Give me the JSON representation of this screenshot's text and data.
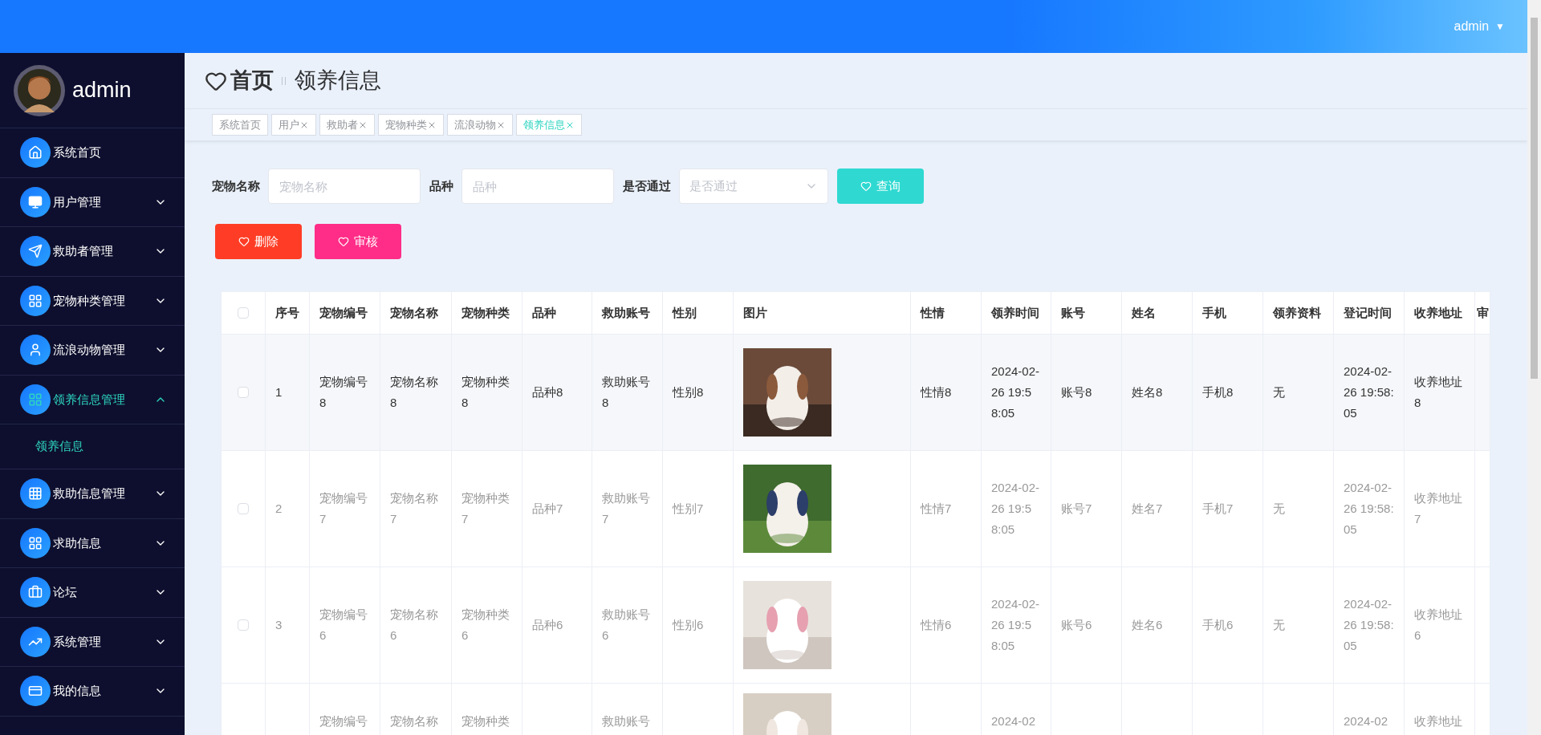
{
  "topbar": {
    "user": "admin",
    "caret": "▼"
  },
  "sidebar": {
    "user": "admin",
    "items": [
      {
        "label": "系统首页",
        "has_children": false,
        "active": false
      },
      {
        "label": "用户管理",
        "has_children": true,
        "expanded": false,
        "active": false
      },
      {
        "label": "救助者管理",
        "has_children": true,
        "expanded": false,
        "active": false
      },
      {
        "label": "宠物种类管理",
        "has_children": true,
        "expanded": false,
        "active": false
      },
      {
        "label": "流浪动物管理",
        "has_children": true,
        "expanded": false,
        "active": false
      },
      {
        "label": "领养信息管理",
        "has_children": true,
        "expanded": true,
        "active": true,
        "children": [
          {
            "label": "领养信息",
            "selected": true
          }
        ]
      },
      {
        "label": "救助信息管理",
        "has_children": true,
        "expanded": false,
        "active": false
      },
      {
        "label": "求助信息",
        "has_children": true,
        "expanded": false,
        "active": false
      },
      {
        "label": "论坛",
        "has_children": true,
        "expanded": false,
        "active": false
      },
      {
        "label": "系统管理",
        "has_children": true,
        "expanded": false,
        "active": false
      },
      {
        "label": "我的信息",
        "has_children": true,
        "expanded": false,
        "active": false
      }
    ]
  },
  "breadcrumb": {
    "home": "首页",
    "current": "领养信息"
  },
  "tabs": [
    {
      "label": "系统首页",
      "closable": false,
      "selected": false
    },
    {
      "label": "用户",
      "closable": true,
      "selected": false
    },
    {
      "label": "救助者",
      "closable": true,
      "selected": false
    },
    {
      "label": "宠物种类",
      "closable": true,
      "selected": false
    },
    {
      "label": "流浪动物",
      "closable": true,
      "selected": false
    },
    {
      "label": "领养信息",
      "closable": true,
      "selected": true
    }
  ],
  "search": {
    "fields": [
      {
        "label": "宠物名称",
        "placeholder": "宠物名称",
        "kind": "input"
      },
      {
        "label": "品种",
        "placeholder": "品种",
        "kind": "input"
      },
      {
        "label": "是否通过",
        "placeholder": "是否通过",
        "kind": "select"
      }
    ],
    "button": "查询"
  },
  "actions": [
    {
      "label": "删除",
      "color": "#ff3d26"
    },
    {
      "label": "审核",
      "color": "#ff2d87"
    }
  ],
  "table": {
    "all_checked": false,
    "columns": [
      "序号",
      "宠物编号",
      "宠物名称",
      "宠物种类",
      "品种",
      "救助账号",
      "性别",
      "图片",
      "性情",
      "领养时间",
      "账号",
      "姓名",
      "手机",
      "领养资料",
      "登记时间",
      "收养地址",
      "审"
    ],
    "rows": [
      {
        "hovered": true,
        "cut": false,
        "checked": false,
        "cells": [
          "1",
          "宠物编号8",
          "宠物名称8",
          "宠物种类8",
          "品种8",
          "救助账号8",
          "性别8",
          {
            "kind": "picture"
          },
          "性情8",
          "2024-02-26 19:58:05",
          "账号8",
          "姓名8",
          "手机8",
          "无",
          "2024-02-26 19:58:05",
          "收养地址8",
          ""
        ]
      },
      {
        "hovered": false,
        "cut": false,
        "checked": false,
        "cells": [
          "2",
          "宠物编号7",
          "宠物名称7",
          "宠物种类7",
          "品种7",
          "救助账号7",
          "性别7",
          {
            "kind": "picture"
          },
          "性情7",
          "2024-02-26 19:58:05",
          "账号7",
          "姓名7",
          "手机7",
          "无",
          "2024-02-26 19:58:05",
          "收养地址7",
          ""
        ]
      },
      {
        "hovered": false,
        "cut": false,
        "checked": false,
        "cells": [
          "3",
          "宠物编号6",
          "宠物名称6",
          "宠物种类6",
          "品种6",
          "救助账号6",
          "性别6",
          {
            "kind": "picture"
          },
          "性情6",
          "2024-02-26 19:58:05",
          "账号6",
          "姓名6",
          "手机6",
          "无",
          "2024-02-26 19:58:05",
          "收养地址6",
          ""
        ]
      },
      {
        "hovered": false,
        "cut": true,
        "cells": [
          "",
          "宠物编号",
          "宠物名称",
          "宠物种类",
          "",
          "救助账号",
          "",
          {
            "kind": "picture"
          },
          "",
          "2024-02",
          "",
          "",
          "",
          "",
          "2024-02",
          "收养地址",
          ""
        ]
      }
    ]
  }
}
